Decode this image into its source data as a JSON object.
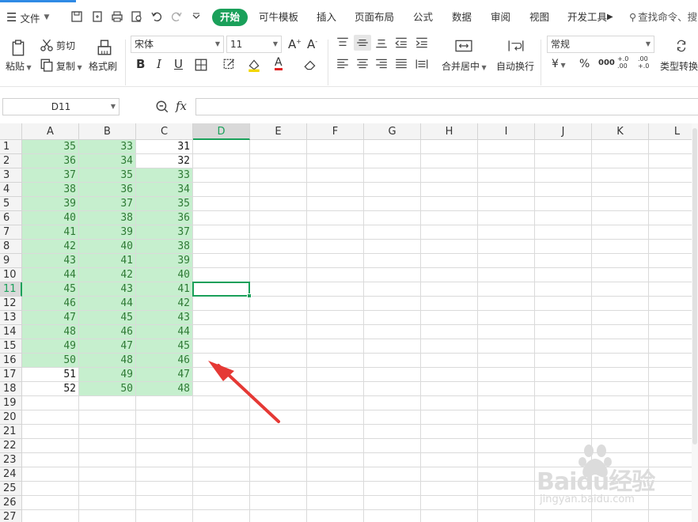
{
  "menu": {
    "file_label": "文件"
  },
  "tabs": [
    {
      "label": "开始",
      "active": true
    },
    {
      "label": "可牛模板"
    },
    {
      "label": "插入"
    },
    {
      "label": "页面布局"
    },
    {
      "label": "公式"
    },
    {
      "label": "数据"
    },
    {
      "label": "审阅"
    },
    {
      "label": "视图"
    },
    {
      "label": "开发工具"
    }
  ],
  "search": {
    "label": "查找命令、搜"
  },
  "ribbon": {
    "paste": "粘贴",
    "cut": "剪切",
    "copy": "复制",
    "format_painter": "格式刷",
    "font_name": "宋体",
    "font_size": "11",
    "merge_center": "合并居中",
    "wrap_text": "自动换行",
    "number_format": "常规",
    "type_convert": "类型转换",
    "currency_symbol": "¥",
    "percent_symbol": "%",
    "thousands_symbol": "000",
    "inc_decimal": "+.0 .00",
    "dec_decimal": ".00 +.0"
  },
  "formula_bar": {
    "cell_ref": "D11",
    "fx_label": "fx",
    "formula": ""
  },
  "columns": [
    "A",
    "B",
    "C",
    "D",
    "E",
    "F",
    "G",
    "H",
    "I",
    "J",
    "K",
    "L"
  ],
  "rows": [
    "1",
    "2",
    "3",
    "4",
    "5",
    "6",
    "7",
    "8",
    "9",
    "10",
    "11",
    "12",
    "13",
    "14",
    "15",
    "16",
    "17",
    "18",
    "19",
    "20",
    "21",
    "22",
    "23",
    "24",
    "25",
    "26",
    "27"
  ],
  "active_cell": {
    "col": "D",
    "row": "11"
  },
  "sheet": {
    "A": [
      "35",
      "36",
      "37",
      "38",
      "39",
      "40",
      "41",
      "42",
      "43",
      "44",
      "45",
      "46",
      "47",
      "48",
      "49",
      "50",
      "51",
      "52"
    ],
    "B": [
      "33",
      "34",
      "35",
      "36",
      "37",
      "38",
      "39",
      "40",
      "41",
      "42",
      "43",
      "44",
      "45",
      "46",
      "47",
      "48",
      "49",
      "50"
    ],
    "C": [
      "31",
      "32",
      "33",
      "34",
      "35",
      "36",
      "37",
      "38",
      "39",
      "40",
      "41",
      "42",
      "43",
      "44",
      "45",
      "46",
      "47",
      "48"
    ]
  },
  "highlight": {
    "A": [
      true,
      true,
      true,
      true,
      true,
      true,
      true,
      true,
      true,
      true,
      true,
      true,
      true,
      true,
      true,
      true,
      false,
      false
    ],
    "B": [
      true,
      true,
      true,
      true,
      true,
      true,
      true,
      true,
      true,
      true,
      true,
      true,
      true,
      true,
      true,
      true,
      true,
      true
    ],
    "C": [
      false,
      false,
      true,
      true,
      true,
      true,
      true,
      true,
      true,
      true,
      true,
      true,
      true,
      true,
      true,
      true,
      true,
      true
    ]
  },
  "colors": {
    "accent": "#1aa05a",
    "highlight_fill": "#c6efce",
    "highlight_text": "#2f7a35",
    "arrow": "#e53935"
  },
  "watermark": {
    "brand": "Baidu经验",
    "url": "jingyan.baidu.com"
  }
}
